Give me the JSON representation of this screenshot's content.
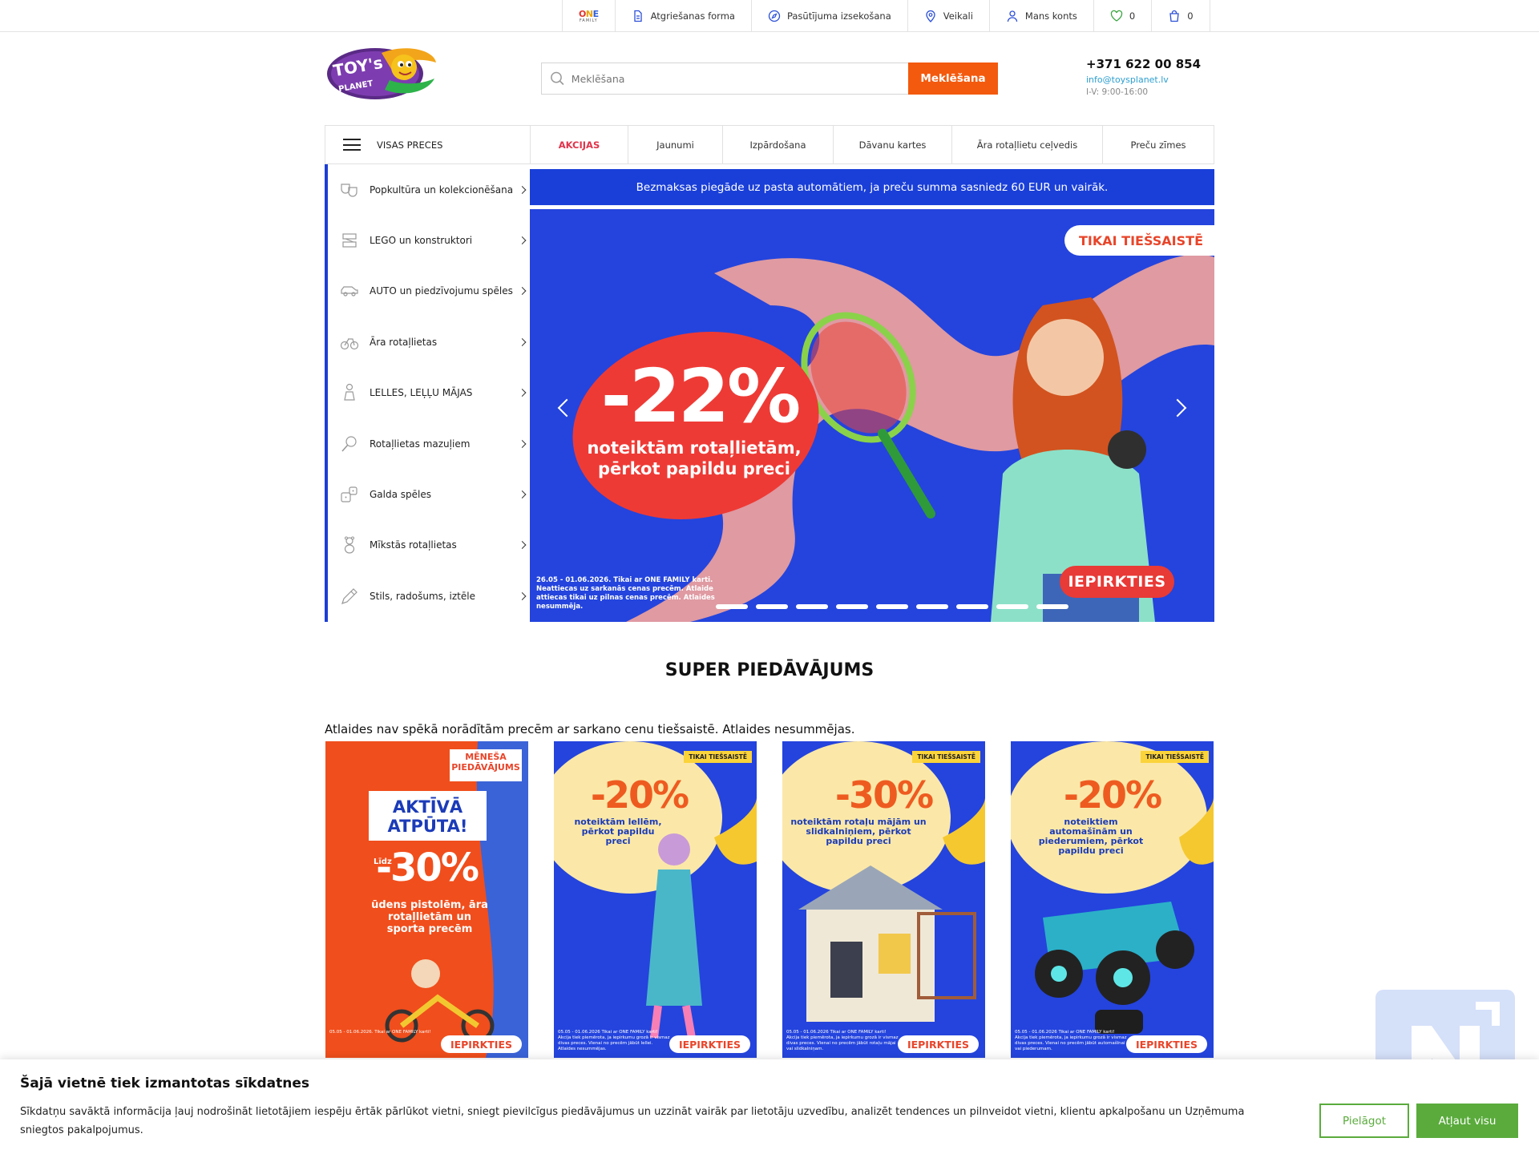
{
  "topbar": {
    "brand_mark": "ONE",
    "brand_sub": "FAMILY",
    "items": [
      {
        "label": "Atgriešanas forma",
        "icon": "document-icon"
      },
      {
        "label": "Pasūtījuma izsekošana",
        "icon": "compass-icon"
      },
      {
        "label": "Veikali",
        "icon": "location-pin-icon"
      },
      {
        "label": "Mans konts",
        "icon": "user-icon"
      }
    ],
    "wishlist_count": "0",
    "cart_count": "0"
  },
  "header": {
    "logo_text": "TOY's PLANET",
    "search_placeholder": "Meklēšana",
    "search_button": "Meklēšana",
    "phone": "+371 622 00 854",
    "email": "info@toysplanet.lv",
    "hours": "I-V: 9:00-16:00"
  },
  "nav": {
    "all_label": "VISAS PRECES",
    "items": [
      "AKCIJAS",
      "Jaunumi",
      "Izpārdošana",
      "Dāvanu kartes",
      "Āra rotaļlietu ceļvedis",
      "Preču zīmes"
    ]
  },
  "sidebar": {
    "categories": [
      "Popkultūra un kolekcionēšana",
      "LEGO un konstruktori",
      "AUTO un piedzīvojumu spēles",
      "Āra rotaļlietas",
      "LELLES, LEĻĻU MĀJAS",
      "Rotaļlietas mazuļiem",
      "Galda spēles",
      "Mīkstās rotaļlietas",
      "Stils, radošums, iztēle"
    ]
  },
  "promo_strip": "Bezmaksas piegāde uz pasta automātiem, ja preču summa sasniedz 60 EUR un vairāk.",
  "hero": {
    "badge": "TIKAI TIEŠSAISTĒ",
    "discount": "-22%",
    "subtitle": "noteiktām rotaļlietām, pērkot papildu preci",
    "note": "26.05 - 01.06.2026. Tikai ar ONE FAMILY karti. Neattiecas uz sarkanās cenas precēm. Atlaide attiecas tikai uz pilnas cenas precēm. Atlaides nesummēja.",
    "cta": "IEPIRKTIES",
    "slide_count": 9
  },
  "offers_section": {
    "title": "SUPER PIEDĀVĀJUMS",
    "note": "Atlaides nav spēkā norādītām precēm ar sarkano cenu tiešsaistē. Atlaides nesummējas.",
    "cards": [
      {
        "ribbon": "MĒNEŠA PIEDĀVĀJUMS",
        "headline": "AKTĪVĀ ATPŪTA!",
        "prefix": "Līdz",
        "discount": "-30%",
        "desc": "ūdens pistolēm, āra rotaļlietām un sporta precēm",
        "legal": "05.05 - 01.06.2026. Tikai ar ONE FAMILY karti!",
        "cta": "IEPIRKTIES"
      },
      {
        "tag": "TIKAI TIEŠSAISTĒ",
        "discount": "-20%",
        "desc": "noteiktām lellēm, pērkot papildu preci",
        "legal": "05.05 - 01.06.2026 Tikai ar ONE FAMILY karti! Akcija tiek piemērota, ja iepirkumu grozā ir vismaz divas preces. Vienai no precēm jābūt lellei. Atlaides nesummējas.",
        "cta": "IEPIRKTIES"
      },
      {
        "tag": "TIKAI TIEŠSAISTĒ",
        "discount": "-30%",
        "desc": "noteiktām rotaļu mājām un slidkalniņiem, pērkot papildu preci",
        "legal": "05.05 - 01.06.2026 Tikai ar ONE FAMILY karti! Akcija tiek piemērota, ja iepirkumu grozā ir vismaz divas preces. Vienai no precēm jābūt rotaļu mājai vai slidkalniņam.",
        "cta": "IEPIRKTIES"
      },
      {
        "tag": "TIKAI TIEŠSAISTĒ",
        "discount": "-20%",
        "desc": "noteiktiem automašīnām un piederumiem, pērkot papildu preci",
        "legal": "05.05 - 01.06.2026 Tikai ar ONE FAMILY karti! Akcija tiek piemērota, ja iepirkumu grozā ir vismaz divas preces. Vienai no precēm jābūt automašīnai vai piederumam.",
        "cta": "IEPIRKTIES"
      }
    ]
  },
  "cookie": {
    "title": "Šajā vietnē tiek izmantotas sīkdatnes",
    "text": "Sīkdatņu savāktā informācija ļauj nodrošināt lietotājiem iespēju ērtāk pārlūkot vietni, sniegt pievilcīgus piedāvājumus un uzzināt vairāk par lietotāju uzvedību, analizēt tendences un pilnveidot vietni, klientu apkalpošanu un Uzņēmuma sniegtos pakalpojumus.",
    "customize": "Pielāgot",
    "allow": "Atļaut visu"
  },
  "colors": {
    "accent_orange": "#f35a0e",
    "brand_blue": "#1a3fd8",
    "promo_red": "#e0334a",
    "cookie_green": "#5aab3c"
  }
}
